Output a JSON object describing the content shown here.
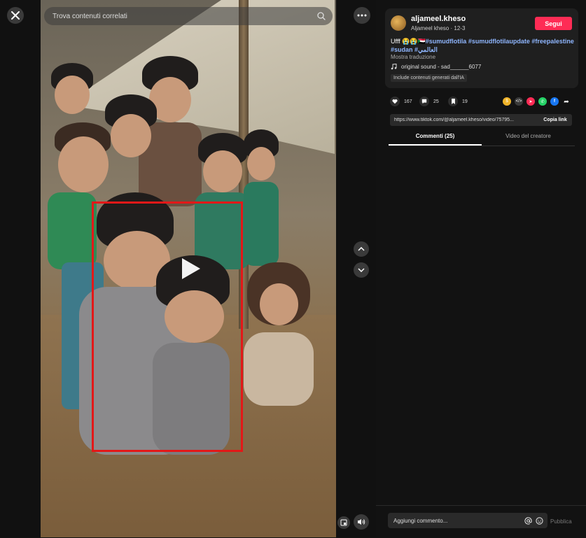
{
  "search": {
    "placeholder": "Trova contenuti correlati"
  },
  "author": {
    "username": "aljameel.kheso",
    "display_name": "Aljameel kheso",
    "date": "12-3",
    "follow_label": "Segui"
  },
  "caption": {
    "lead": "Ufff 😭😭🇸🇩",
    "tags": [
      "#sumudflotila",
      "#sumudflotilaupdate",
      "#freepalestine",
      "#sudan",
      "#العالمي"
    ],
    "translate_label": "Mostra traduzione"
  },
  "sound": {
    "icon": "music-note-icon",
    "label": "original sound - sad______6077"
  },
  "ai_label": "Include contenuti generati dall'IA",
  "stats": {
    "likes": "167",
    "comments": "25",
    "saves": "19"
  },
  "share_icons": [
    "coin-icon",
    "embed-icon",
    "send-icon",
    "whatsapp-icon",
    "facebook-icon",
    "share-arrow-icon"
  ],
  "share_colors": {
    "coin": "#f0b429",
    "embed": "#3a3a3a",
    "send": "#fe2c55",
    "whatsapp": "#25d366",
    "facebook": "#1877f2",
    "share": "#121212"
  },
  "link": {
    "url": "https://www.tiktok.com/@aljameel.kheso/video/75795...",
    "copy_label": "Copia link"
  },
  "tabs": [
    {
      "label": "Commenti (25)",
      "active": true
    },
    {
      "label": "Video del creatore",
      "active": false
    }
  ],
  "comment_box": {
    "placeholder": "Aggiungi commento...",
    "publish_label": "Pubblica"
  },
  "colors": {
    "accent": "#fe2c55",
    "highlight": "#e31818",
    "panel_bg": "#121212"
  }
}
